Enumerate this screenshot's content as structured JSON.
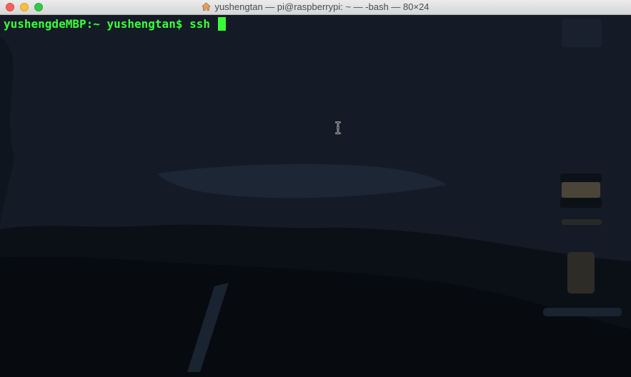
{
  "window": {
    "title": "yushengtan — pi@raspberrypi: ~ — -bash — 80×24",
    "title_icon": "home-icon",
    "buttons": [
      "close",
      "minimize",
      "zoom"
    ]
  },
  "terminal": {
    "prompt": "yushengdeMBP:~ yushengtan$ ",
    "command": "ssh ",
    "text_color": "#39ff39",
    "background_color": "#141b26"
  },
  "pointer": "text-cursor-icon"
}
